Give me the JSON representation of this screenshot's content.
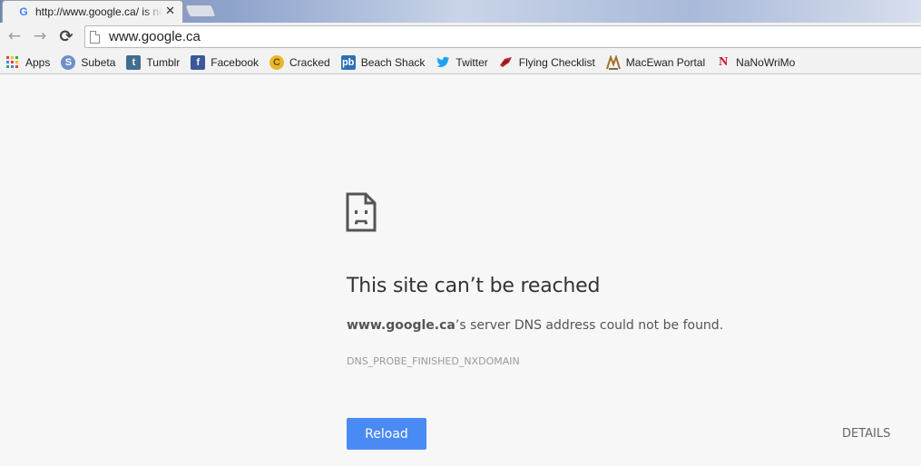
{
  "tab": {
    "title": "http://www.google.ca/ is not available",
    "close_glyph": "✕",
    "favicon": "google-icon"
  },
  "toolbar": {
    "back_glyph": "←",
    "forward_glyph": "→",
    "reload_glyph": "⟳",
    "url": "www.google.ca"
  },
  "bookmarks": [
    {
      "label": "Apps",
      "icon": "apps-grid-icon"
    },
    {
      "label": "Subeta",
      "icon": "subeta-icon"
    },
    {
      "label": "Tumblr",
      "icon": "tumblr-icon"
    },
    {
      "label": "Facebook",
      "icon": "facebook-icon"
    },
    {
      "label": "Cracked",
      "icon": "cracked-icon"
    },
    {
      "label": "Beach Shack",
      "icon": "photobucket-icon"
    },
    {
      "label": "Twitter",
      "icon": "twitter-icon"
    },
    {
      "label": "Flying Checklist",
      "icon": "flylady-icon"
    },
    {
      "label": "MacEwan Portal",
      "icon": "macewan-icon"
    },
    {
      "label": "NaNoWriMo",
      "icon": "nanowrimo-icon"
    }
  ],
  "error": {
    "heading": "This site can’t be reached",
    "domain": "www.google.ca",
    "description_suffix": "’s server DNS address could not be found.",
    "code": "DNS_PROBE_FINISHED_NXDOMAIN",
    "reload_label": "Reload",
    "details_label": "DETAILS"
  },
  "colors": {
    "accent": "#4a8af4",
    "page_bg": "#f7f7f7"
  }
}
